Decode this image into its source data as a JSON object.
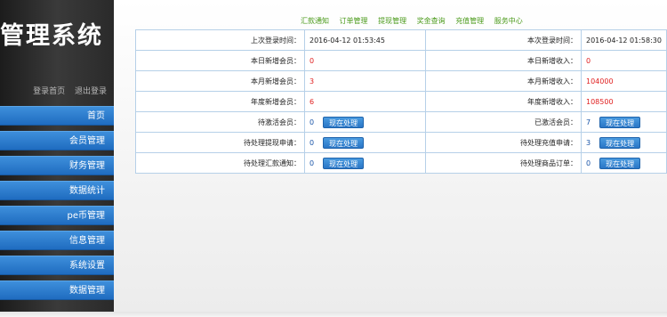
{
  "sidebar": {
    "title": "管理系统",
    "user_links": [
      "登录首页",
      "退出登录"
    ],
    "items": [
      "首页",
      "会员管理",
      "财务管理",
      "数据统计",
      "pe币管理",
      "信息管理",
      "系统设置",
      "数据管理"
    ]
  },
  "topnav": [
    "汇款通知",
    "订单管理",
    "提现管理",
    "奖金查询",
    "充值管理",
    "服务中心"
  ],
  "button_label": "现在处理",
  "rows": [
    {
      "l1": "上次登录时间：",
      "v1": "2016-04-12 01:53:45",
      "l2": "本次登录时间：",
      "v2": "2016-04-12 01:58:30"
    },
    {
      "l1": "本日新增会员：",
      "v1": "0",
      "l2": "本日新增收入：",
      "v2": "0"
    },
    {
      "l1": "本月新增会员：",
      "v1": "3",
      "l2": "本月新增收入：",
      "v2": "104000"
    },
    {
      "l1": "年度新增会员：",
      "v1": "6",
      "l2": "年度新增收入：",
      "v2": "108500"
    },
    {
      "l1": "待激活会员：",
      "v1": "0",
      "l2": "已激活会员：",
      "v2": "7"
    },
    {
      "l1": "待处理提现申请：",
      "v1": "0",
      "l2": "待处理充值申请：",
      "v2": "3"
    },
    {
      "l1": "待处理汇款通知：",
      "v1": "0",
      "l2": "待处理商品订单：",
      "v2": "0"
    }
  ]
}
